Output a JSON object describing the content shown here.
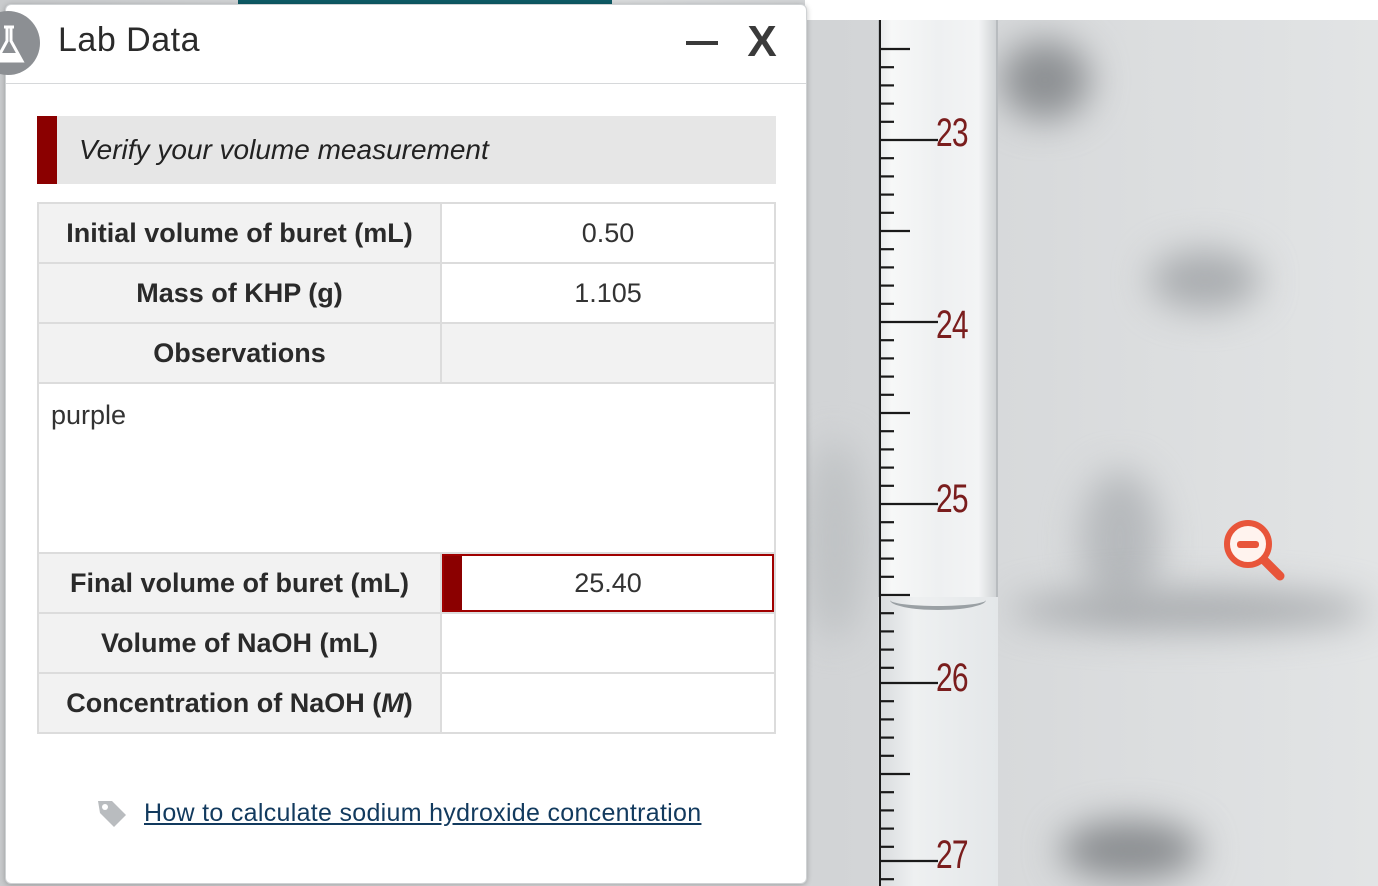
{
  "dialog": {
    "title": "Lab Data",
    "minimize_label": "—",
    "close_label": "X",
    "banner": "Verify your volume measurement",
    "rows": {
      "initial_volume_label": "Initial volume of buret (mL)",
      "initial_volume_value": "0.50",
      "mass_khp_label": "Mass of KHP (g)",
      "mass_khp_value": "1.105",
      "observations_label": "Observations",
      "observations_value": "purple",
      "final_volume_label": "Final volume of buret (mL)",
      "final_volume_value": "25.40",
      "volume_naoh_label": "Volume of NaOH (mL)",
      "volume_naoh_value": "",
      "concentration_label_pre": "Concentration of NaOH (",
      "concentration_label_unit": "M",
      "concentration_label_post": ")",
      "concentration_value": ""
    },
    "help_link": "How to calculate sodium hydroxide concentration"
  },
  "buret": {
    "scale_labels": [
      "23",
      "24",
      "25",
      "26",
      "27"
    ],
    "reading_mL": 25.4
  },
  "colors": {
    "accent_red": "#8b0000",
    "link_blue": "#123a5e",
    "scale_red": "#7a1d1d",
    "zoom_orange": "#e8553a"
  },
  "icons": [
    "flask-icon",
    "tag-icon",
    "zoom-out-icon"
  ]
}
